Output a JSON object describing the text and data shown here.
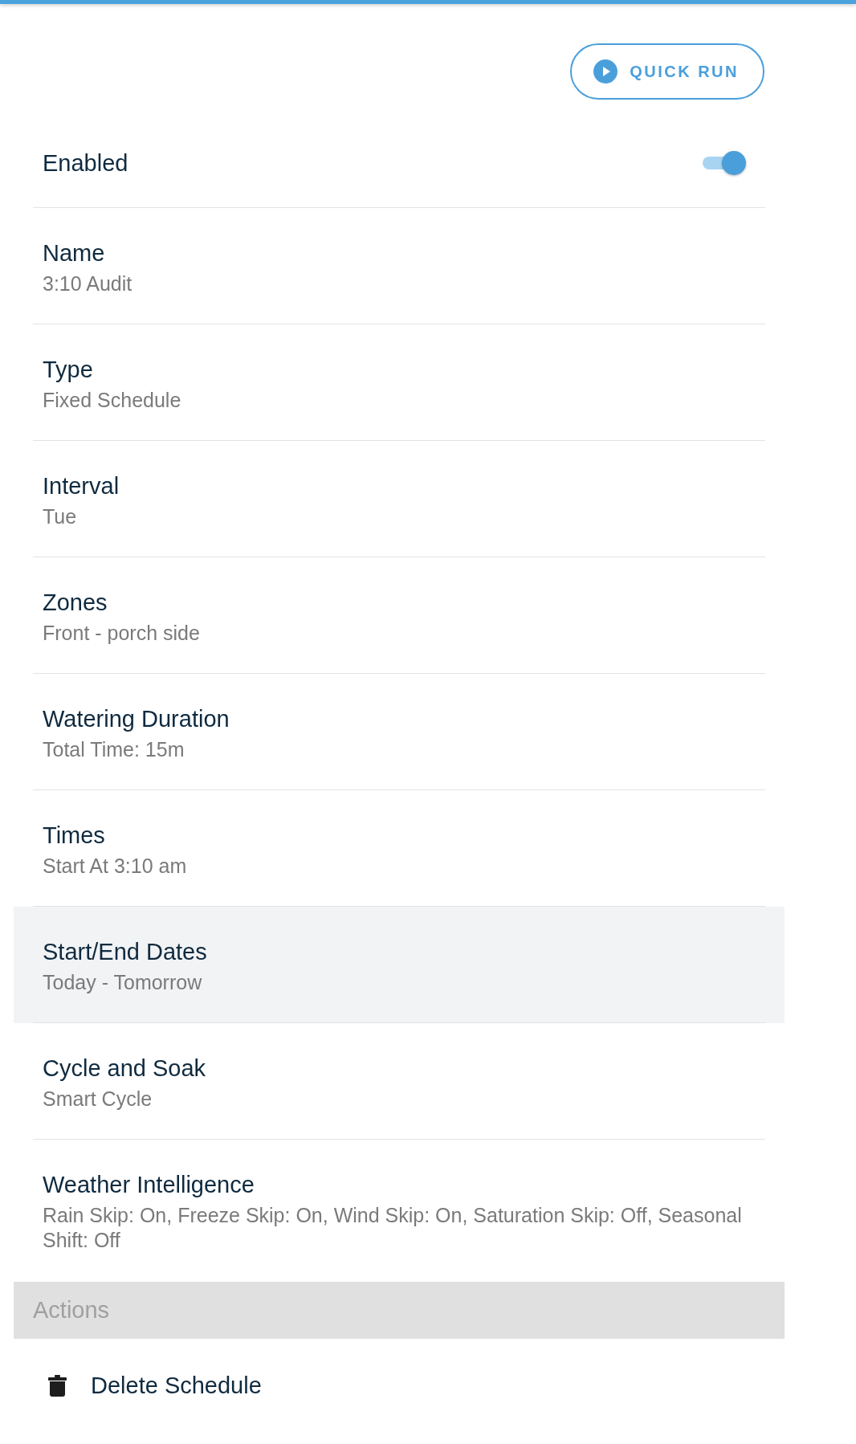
{
  "quick_run": {
    "label": "QUICK RUN"
  },
  "enabled": {
    "label": "Enabled",
    "on": true
  },
  "settings": [
    {
      "label": "Name",
      "value": "3:10 Audit",
      "selected": false
    },
    {
      "label": "Type",
      "value": "Fixed Schedule",
      "selected": false
    },
    {
      "label": "Interval",
      "value": "Tue",
      "selected": false
    },
    {
      "label": "Zones",
      "value": "Front - porch side",
      "selected": false
    },
    {
      "label": "Watering Duration",
      "value": "Total Time: 15m",
      "selected": false
    },
    {
      "label": "Times",
      "value": "Start At 3:10 am",
      "selected": false
    },
    {
      "label": "Start/End Dates",
      "value": "Today - Tomorrow",
      "selected": true
    },
    {
      "label": "Cycle and Soak",
      "value": "Smart Cycle",
      "selected": false
    },
    {
      "label": "Weather Intelligence",
      "value": "Rain Skip: On, Freeze Skip: On, Wind Skip: On, Saturation Skip: Off, Seasonal Shift: Off",
      "selected": false
    }
  ],
  "actions": {
    "title": "Actions",
    "items": [
      {
        "label": "Delete Schedule"
      }
    ]
  }
}
